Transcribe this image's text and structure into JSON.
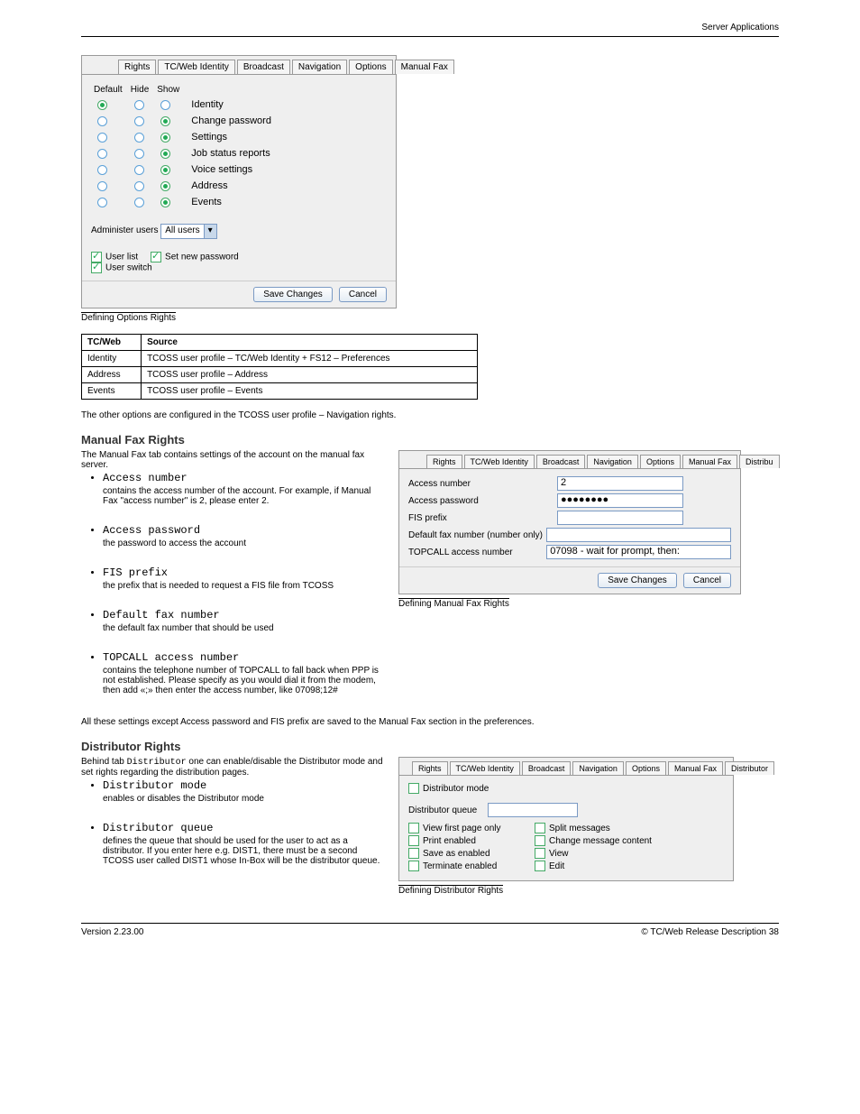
{
  "header": "Server Applications",
  "panel1": {
    "tabs": [
      "Rights",
      "TC/Web Identity",
      "Broadcast",
      "Navigation",
      "Options",
      "Manual Fax"
    ],
    "cols": [
      "Default",
      "Hide",
      "Show"
    ],
    "rows": [
      {
        "label": "Identity",
        "sel": 0
      },
      {
        "label": "Change password",
        "sel": 2
      },
      {
        "label": "Settings",
        "sel": 2
      },
      {
        "label": "Job status reports",
        "sel": 2
      },
      {
        "label": "Voice settings",
        "sel": 2
      },
      {
        "label": "Address",
        "sel": 2
      },
      {
        "label": "Events",
        "sel": 2
      }
    ],
    "administer_lbl": "Administer users",
    "administer_sel": "All users",
    "userlist": "User list",
    "setnewpw": "Set new password",
    "userswitch": "User switch",
    "save": "Save Changes",
    "cancel": "Cancel",
    "caption": "Defining Options Rights"
  },
  "table": {
    "head": [
      "TC/Web",
      "Source"
    ],
    "rows": [
      [
        "Identity",
        "TCOSS user profile – TC/Web Identity + FS12 – Preferences"
      ],
      [
        "Address",
        "TCOSS user profile – Address"
      ],
      [
        "Events",
        "TCOSS user profile – Events"
      ]
    ],
    "caption": "The other options are configured in the TCOSS user profile – Navigation rights."
  },
  "sec_manualfax": {
    "title": "Manual Fax Rights",
    "text": "The Manual Fax tab contains settings of the account on the manual fax server.",
    "items": [
      {
        "name": "Access number",
        "desc": "contains the access number of the account. For example, if Manual Fax \"access number\" is 2, please enter 2."
      },
      {
        "name": "Access password",
        "desc": "the password to access the account"
      },
      {
        "name": "FIS prefix",
        "desc": "the prefix that is needed to request a FIS file from TCOSS"
      },
      {
        "name": "Default fax number",
        "desc": "the default fax number that should be used"
      },
      {
        "name": "TOPCALL access number",
        "desc": "contains the telephone number of TOPCALL to fall back when PPP is not established. Please specify as you would dial it from the modem, then add «;» then enter the access number, like 07098;12#"
      }
    ]
  },
  "panel2": {
    "tabs": [
      "Rights",
      "TC/Web Identity",
      "Broadcast",
      "Navigation",
      "Options",
      "Manual Fax",
      "Distribu"
    ],
    "rows": [
      {
        "label": "Access number",
        "value": "2"
      },
      {
        "label": "Access password",
        "value": "●●●●●●●●"
      },
      {
        "label": "FIS prefix",
        "value": ""
      },
      {
        "label": "Default fax number (number only)",
        "value": ""
      },
      {
        "label": "TOPCALL access number",
        "value": "07098 - wait for prompt, then:"
      }
    ],
    "save": "Save Changes",
    "cancel": "Cancel",
    "caption": "Defining Manual Fax Rights"
  },
  "note": "All these settings except Access password and FIS prefix are saved to the Manual Fax section in the preferences.",
  "sec_distributor": {
    "title": "Distributor Rights",
    "intro_1": "Behind tab ",
    "intro_name": "Distributor",
    "intro_2": " one can enable/disable the Distributor mode and set rights regarding the distribution pages.",
    "items": [
      {
        "name": "Distributor mode",
        "desc": "enables or disables the Distributor mode"
      },
      {
        "name": "Distributor queue",
        "desc": "defines the queue that should be used for the user to act as a distributor. If you enter here e.g. DIST1, there must be a second TCOSS user called DIST1 whose In-Box will be the distributor queue."
      }
    ]
  },
  "panel3": {
    "tabs": [
      "Rights",
      "TC/Web Identity",
      "Broadcast",
      "Navigation",
      "Options",
      "Manual Fax",
      "Distributor"
    ],
    "distmode": "Distributor mode",
    "distqueue": "Distributor queue",
    "chk": [
      "View first page only",
      "Split messages",
      "Print enabled",
      "Change message content",
      "Save as enabled",
      "View",
      "Terminate enabled",
      "Edit"
    ],
    "caption": "Defining Distributor Rights"
  },
  "footer": {
    "left": "Version 2.23.00",
    "right": "© TC/Web Release Description 38"
  }
}
